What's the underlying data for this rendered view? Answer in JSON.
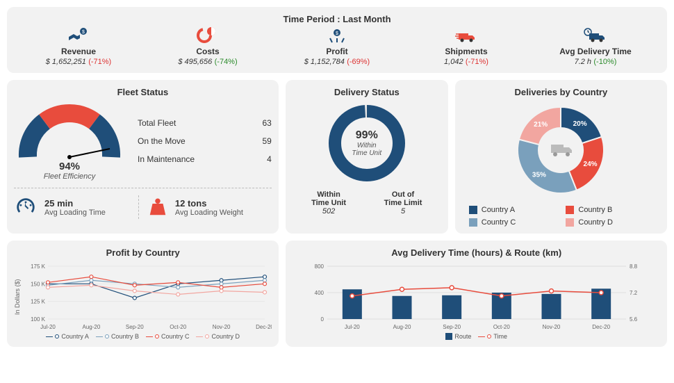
{
  "time_period_label": "Time Period : Last Month",
  "kpis": [
    {
      "icon": "revenue",
      "label": "Revenue",
      "value": "$ 1,652,251",
      "delta": "(-71%)",
      "delta_class": "neg-red"
    },
    {
      "icon": "costs",
      "label": "Costs",
      "value": "$ 495,656",
      "delta": "(-74%)",
      "delta_class": "neg-green"
    },
    {
      "icon": "profit",
      "label": "Profit",
      "value": "$ 1,152,784",
      "delta": "(-69%)",
      "delta_class": "neg-red"
    },
    {
      "icon": "shipments",
      "label": "Shipments",
      "value": "1,042",
      "delta": "(-71%)",
      "delta_class": "neg-red"
    },
    {
      "icon": "avg-delivery",
      "label": "Avg Delivery Time",
      "value": "7.2 h",
      "delta": "(-10%)",
      "delta_class": "neg-green"
    }
  ],
  "fleet": {
    "title": "Fleet Status",
    "efficiency_pct": "94%",
    "efficiency_label": "Fleet Efficiency",
    "stats": [
      {
        "label": "Total Fleet",
        "value": "63"
      },
      {
        "label": "On the Move",
        "value": "59"
      },
      {
        "label": "In Maintenance",
        "value": "4"
      }
    ],
    "loading_time": "25 min",
    "loading_time_label": "Avg Loading Time",
    "loading_weight": "12 tons",
    "loading_weight_label": "Avg Loading Weight"
  },
  "delivery_status": {
    "title": "Delivery Status",
    "pct": "99%",
    "pct_label": "Within\nTime Unit",
    "within_label": "Within\nTime Unit",
    "within_count": "502",
    "out_label": "Out of\nTime Limit",
    "out_count": "5"
  },
  "countries_pie": {
    "title": "Deliveries by Country",
    "slices": [
      {
        "name": "Country A",
        "pct": 20,
        "color": "#1f4e79"
      },
      {
        "name": "Country B",
        "pct": 24,
        "color": "#e84c3d"
      },
      {
        "name": "Country C",
        "pct": 35,
        "color": "#7aa0bc"
      },
      {
        "name": "Country D",
        "pct": 21,
        "color": "#f2a6a0"
      }
    ]
  },
  "profit_chart": {
    "title": "Profit by Country",
    "ylabel": "In Dollars ($)",
    "yticks": [
      "100 K",
      "125 K",
      "150 K",
      "175 K"
    ],
    "xlabels": [
      "Jul-20",
      "Aug-20",
      "Sep-20",
      "Oct-20",
      "Nov-20",
      "Dec-20"
    ],
    "series": [
      {
        "name": "Country A",
        "color": "#1f4e79"
      },
      {
        "name": "Country B",
        "color": "#7aa0bc"
      },
      {
        "name": "Country C",
        "color": "#e84c3d"
      },
      {
        "name": "Country D",
        "color": "#f2a6a0"
      }
    ]
  },
  "route_chart": {
    "title": "Avg Delivery Time (hours) & Route (km)",
    "xlabels": [
      "Jul-20",
      "Aug-20",
      "Sep-20",
      "Oct-20",
      "Nov-20",
      "Dec-20"
    ],
    "yticks_left": [
      "0",
      "400",
      "800"
    ],
    "yticks_right": [
      "5.6",
      "7.2",
      "8.8"
    ],
    "legend": [
      {
        "name": "Route",
        "type": "bar",
        "color": "#1f4e79"
      },
      {
        "name": "Time",
        "type": "line",
        "color": "#e84c3d"
      }
    ]
  },
  "chart_data": [
    {
      "type": "gauge",
      "title": "Fleet Efficiency",
      "value_pct": 94
    },
    {
      "type": "donut",
      "title": "Delivery Status",
      "series": [
        {
          "name": "Within Time Unit",
          "value": 502
        },
        {
          "name": "Out of Time Limit",
          "value": 5
        }
      ],
      "center_pct": 99
    },
    {
      "type": "pie",
      "title": "Deliveries by Country",
      "series": [
        {
          "name": "Country A",
          "value": 20
        },
        {
          "name": "Country B",
          "value": 24
        },
        {
          "name": "Country C",
          "value": 35
        },
        {
          "name": "Country D",
          "value": 21
        }
      ]
    },
    {
      "type": "line",
      "title": "Profit by Country",
      "xlabel": "",
      "ylabel": "In Dollars ($)",
      "ylim": [
        100,
        175
      ],
      "categories": [
        "Jul-20",
        "Aug-20",
        "Sep-20",
        "Oct-20",
        "Nov-20",
        "Dec-20"
      ],
      "series": [
        {
          "name": "Country A",
          "values": [
            150,
            150,
            130,
            150,
            155,
            160
          ]
        },
        {
          "name": "Country B",
          "values": [
            148,
            155,
            150,
            145,
            150,
            155
          ]
        },
        {
          "name": "Country C",
          "values": [
            152,
            160,
            148,
            152,
            145,
            150
          ]
        },
        {
          "name": "Country D",
          "values": [
            145,
            148,
            140,
            135,
            140,
            138
          ]
        }
      ]
    },
    {
      "type": "combo",
      "title": "Avg Delivery Time (hours) & Route (km)",
      "categories": [
        "Jul-20",
        "Aug-20",
        "Sep-20",
        "Oct-20",
        "Nov-20",
        "Dec-20"
      ],
      "series": [
        {
          "name": "Route",
          "type": "bar",
          "axis": "left",
          "values": [
            450,
            350,
            360,
            400,
            380,
            460
          ]
        },
        {
          "name": "Time",
          "type": "line",
          "axis": "right",
          "values": [
            7.0,
            7.4,
            7.5,
            7.0,
            7.3,
            7.2
          ]
        }
      ],
      "ylim_left": [
        0,
        800
      ],
      "ylim_right": [
        5.6,
        8.8
      ]
    }
  ]
}
